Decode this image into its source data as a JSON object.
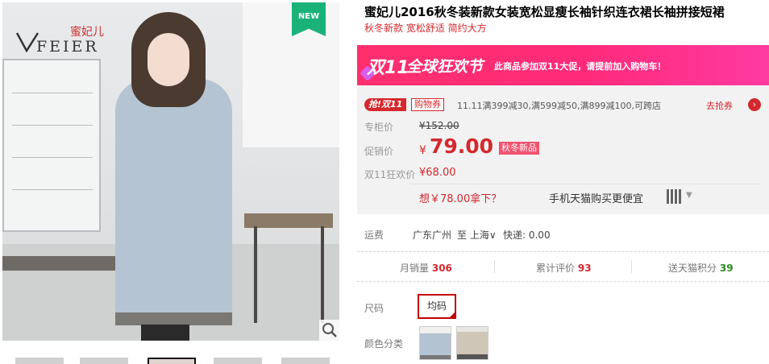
{
  "gallery": {
    "brand_cn": "蜜妃儿",
    "brand_en": "FEIER",
    "badge": "NEW",
    "icons": {
      "zoom": "magnifier-icon"
    }
  },
  "product": {
    "title": "蜜妃儿2016秋冬装新款女装宽松显瘦长袖针织连衣裙长袖拼接短裙",
    "subtitle": "秋冬新款 宽松舒适 简约大方"
  },
  "banner": {
    "logo_11": "双11",
    "fest": "全球狂欢节",
    "note": "此商品参加双11大促，请提前加入购物车！",
    "colors": {
      "start": "#ff2f6d",
      "end": "#ff3aa1"
    }
  },
  "coupon": {
    "tag1": "抢!双11",
    "tag2": "购物券",
    "text": "11.11满399减30,满599减50,满899减100,可跨店",
    "go": "去抢券",
    "arrow_icon": "chevron-right-icon"
  },
  "prices": {
    "orig_label": "专柜价",
    "orig_value": "¥152.00",
    "sale_label": "促销价",
    "sale_yen": "¥",
    "sale_value": "79.00",
    "sale_tag": "秋冬新品",
    "d11_label": "双11狂欢价",
    "d11_value": "¥68.00",
    "want": "想￥78.00拿下？",
    "want_2": "手机天猫购买更便宜",
    "accent": "#d4282d"
  },
  "shipping": {
    "label": "运费",
    "from": "广东广州",
    "to": "至 上海∨",
    "fee": "快递: 0.00"
  },
  "stats": {
    "monthly_label": "月销量",
    "monthly_value": "306",
    "reviews_label": "累计评价",
    "reviews_value": "93",
    "points_label": "送天猫积分",
    "points_value": "39"
  },
  "options": {
    "size_label": "尺码",
    "size_value": "均码",
    "color_label": "颜色分类"
  }
}
